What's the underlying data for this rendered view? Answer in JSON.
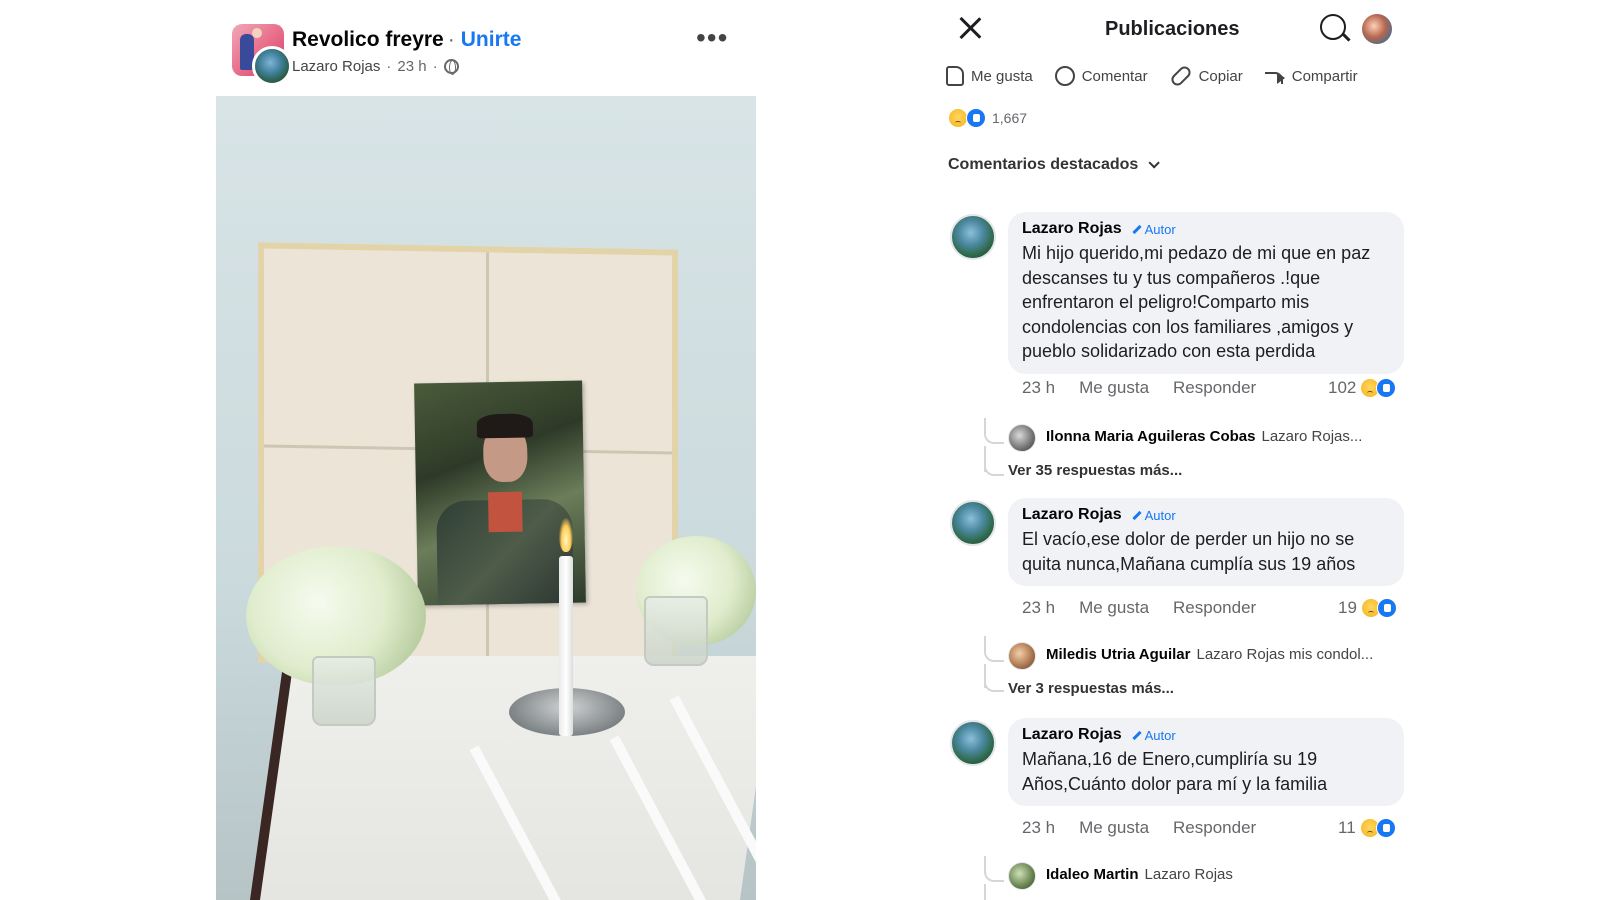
{
  "post": {
    "group_name": "Revolico freyre",
    "join_label": "Unirte",
    "author": "Lazaro Rojas",
    "time": "23 h",
    "more": "•••"
  },
  "panel": {
    "title": "Publicaciones",
    "actions": {
      "like": "Me gusta",
      "comment": "Comentar",
      "copy": "Copiar",
      "share": "Compartir"
    },
    "reaction_count": "1,667",
    "filter_label": "Comentarios destacados"
  },
  "comments": [
    {
      "author": "Lazaro Rojas",
      "badge": "Autor",
      "text": "Mi hijo querido,mi pedazo de mi que en paz descanses tu y tus compañeros .!que enfrentaron el peligro!Comparto mis condolencias con los familiares ,amigos y pueblo solidarizado con esta perdida",
      "time": "23 h",
      "like": "Me gusta",
      "reply": "Responder",
      "reactions": "102",
      "reply_preview_name": "Ilonna Maria Aguileras Cobas",
      "reply_preview_text": "Lazaro Rojas...",
      "more_replies": "Ver 35 respuestas más..."
    },
    {
      "author": "Lazaro Rojas",
      "badge": "Autor",
      "text": "El vacío,ese dolor de perder un hijo no se quita nunca,Mañana cumplía sus 19 años",
      "time": "23 h",
      "like": "Me gusta",
      "reply": "Responder",
      "reactions": "19",
      "reply_preview_name": "Miledis Utria Aguilar",
      "reply_preview_text": "Lazaro Rojas mis condol...",
      "more_replies": "Ver 3 respuestas más..."
    },
    {
      "author": "Lazaro Rojas",
      "badge": "Autor",
      "text": "Mañana,16 de Enero,cumpliría su 19 Años,Cuánto dolor para mí y la familia",
      "time": "23 h",
      "like": "Me gusta",
      "reply": "Responder",
      "reactions": "11",
      "reply_preview_name": "Idaleo Martin",
      "reply_preview_text": "Lazaro Rojas"
    }
  ],
  "colors": {
    "accent": "#1877f2",
    "bubble": "#f0f2f5",
    "secondary_text": "#65676b"
  }
}
